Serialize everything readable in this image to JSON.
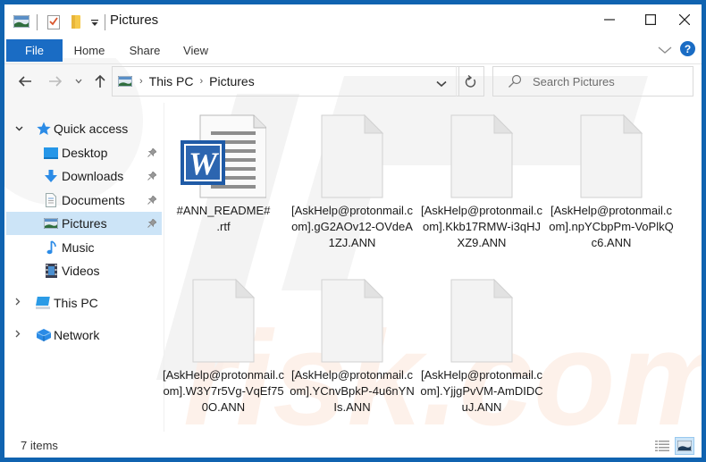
{
  "window": {
    "title": "Pictures",
    "controls": {
      "minimize": "minimize",
      "maximize": "maximize",
      "close": "close"
    }
  },
  "ribbon": {
    "tabs": [
      {
        "label": "File",
        "active": true
      },
      {
        "label": "Home"
      },
      {
        "label": "Share"
      },
      {
        "label": "View"
      }
    ],
    "help_icon": "?"
  },
  "address_bar": {
    "crumbs": [
      "This PC",
      "Pictures"
    ],
    "search_placeholder": "Search Pictures"
  },
  "sidebar": {
    "quick_access": {
      "label": "Quick access",
      "items": [
        {
          "label": "Desktop",
          "icon": "desktop-icon",
          "pinned": true
        },
        {
          "label": "Downloads",
          "icon": "downloads-icon",
          "pinned": true
        },
        {
          "label": "Documents",
          "icon": "documents-icon",
          "pinned": true
        },
        {
          "label": "Pictures",
          "icon": "pictures-icon",
          "pinned": true,
          "selected": true
        },
        {
          "label": "Music",
          "icon": "music-icon",
          "pinned": false
        },
        {
          "label": "Videos",
          "icon": "videos-icon",
          "pinned": false
        }
      ]
    },
    "this_pc": {
      "label": "This PC"
    },
    "network": {
      "label": "Network"
    }
  },
  "files": [
    {
      "name": "#ANN_README#\n.rtf",
      "type": "word-document"
    },
    {
      "name": "[AskHelp@protonmail.com].gG2AOv12-OVdeA1ZJ.ANN",
      "type": "blank"
    },
    {
      "name": "[AskHelp@protonmail.com].Kkb17RMW-i3qHJXZ9.ANN",
      "type": "blank"
    },
    {
      "name": "[AskHelp@protonmail.com].npYCbpPm-VoPlkQc6.ANN",
      "type": "blank"
    },
    {
      "name": "[AskHelp@protonmail.com].W3Y7r5Vg-VqEf750O.ANN",
      "type": "blank"
    },
    {
      "name": "[AskHelp@protonmail.com].YCnvBpkP-4u6nYNIs.ANN",
      "type": "blank"
    },
    {
      "name": "[AskHelp@protonmail.com].YjjgPvVM-AmDIDCuJ.ANN",
      "type": "blank"
    }
  ],
  "status_bar": {
    "item_count": "7 items"
  },
  "colors": {
    "accent": "#1a6cc4",
    "frame": "#1063b0",
    "selection": "#cce4f7"
  }
}
